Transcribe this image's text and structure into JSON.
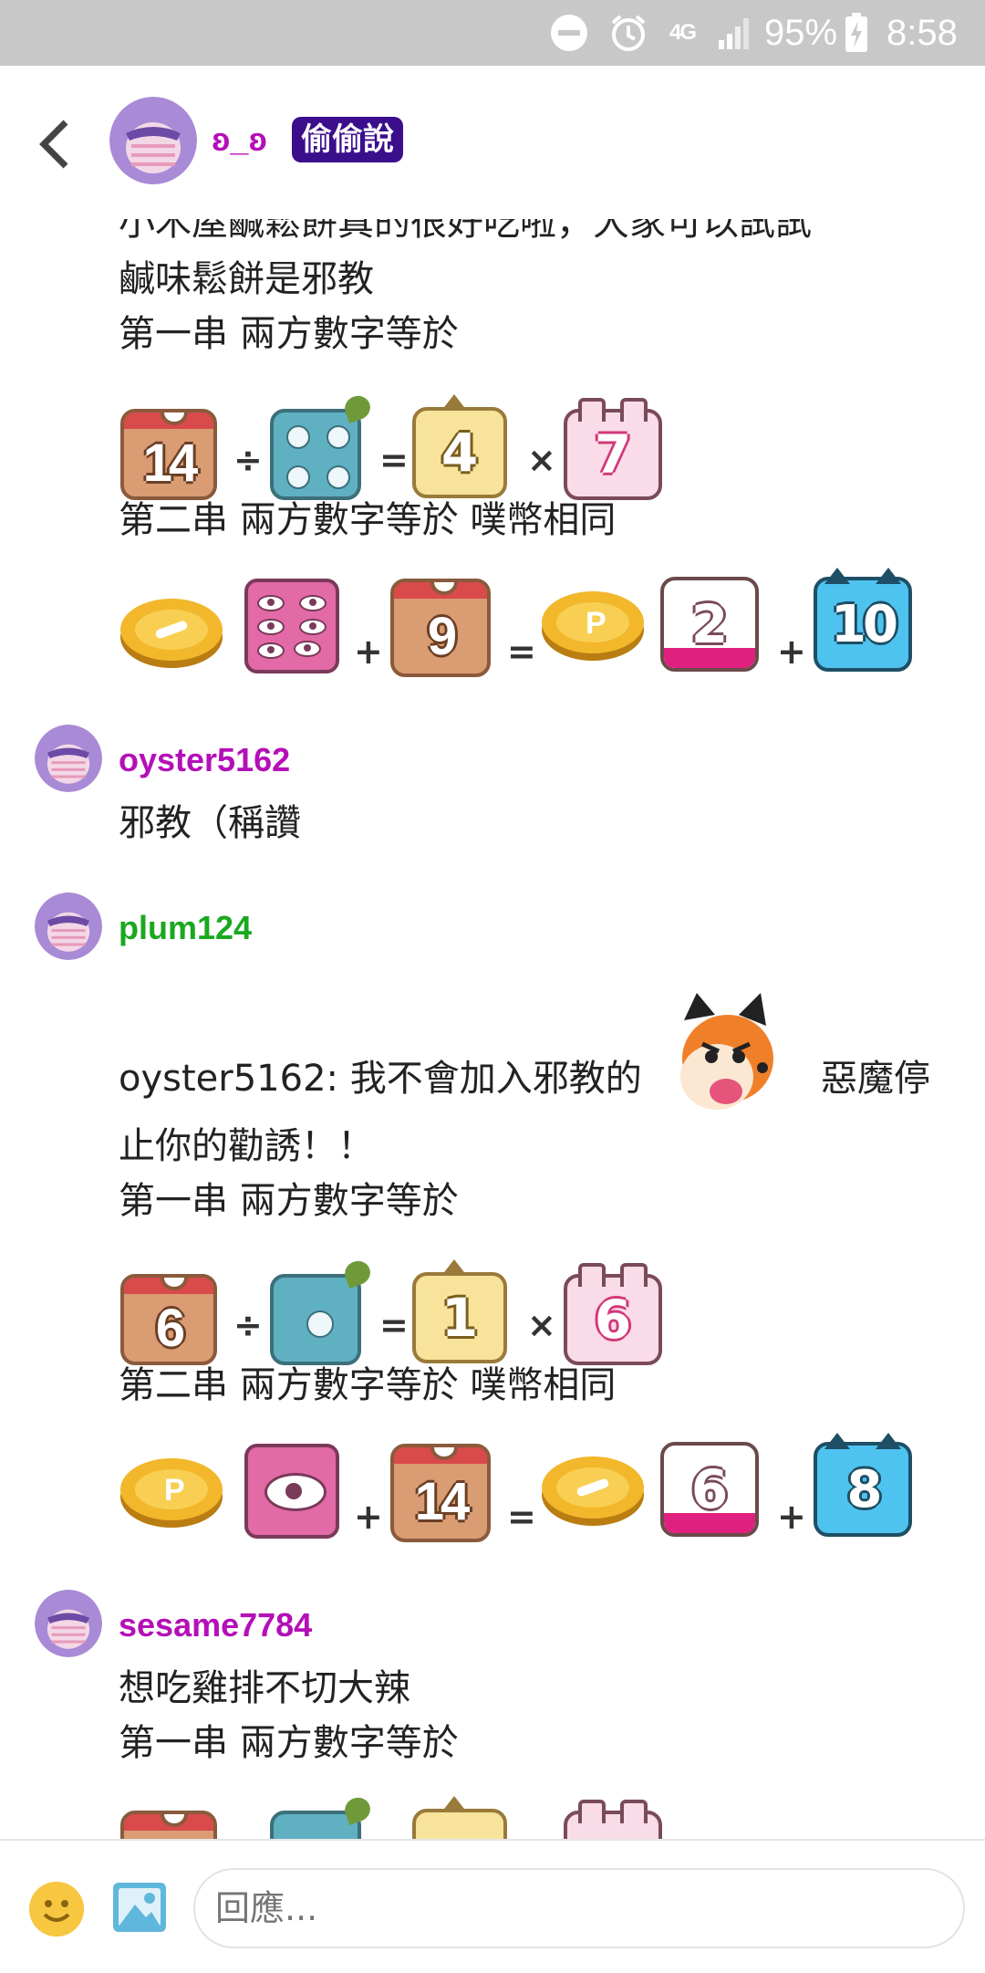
{
  "status_bar": {
    "network": "4G",
    "battery": "95%",
    "time": "8:58",
    "icons": [
      "do-not-disturb-icon",
      "alarm-icon",
      "signal-icon",
      "battery-charging-icon"
    ]
  },
  "header": {
    "author": "ʚ_ʚ",
    "badge": "偷偷說"
  },
  "post": {
    "line_cut": "小木屋鹹鬆餅真的很好吃啦，大家可以試試",
    "line2": "鹹味鬆餅是邪教",
    "row1_label": "第一串 兩方數字等於",
    "row1_values": [
      "14",
      "4",
      "7"
    ],
    "row2_label": "第二串 兩方數字等於 噗幣相同",
    "row2_values": [
      "9",
      "2",
      "10"
    ]
  },
  "comments": [
    {
      "username": "oyster5162",
      "text": "邪教（稱讚",
      "color": "#b40fb8"
    },
    {
      "username": "plum124",
      "color": "#1aa81f",
      "quote_part1": "oyster5162: 我不會加入邪教的",
      "quote_part2": "惡魔停",
      "quote_part3": "止你的勸誘！！",
      "row1_label": "第一串 兩方數字等於",
      "row1_values": [
        "6",
        "1",
        "6"
      ],
      "row2_label": "第二串 兩方數字等於 噗幣相同",
      "row2_values": [
        "14",
        "6",
        "8"
      ]
    },
    {
      "username": "sesame7784",
      "color": "#b40fb8",
      "text": "想吃雞排不切大辣",
      "row1_label": "第一串 兩方數字等於"
    }
  ],
  "operators": {
    "divide": "÷",
    "equals": "=",
    "times": "×",
    "plus": "+"
  },
  "reply": {
    "placeholder": "回應..."
  }
}
